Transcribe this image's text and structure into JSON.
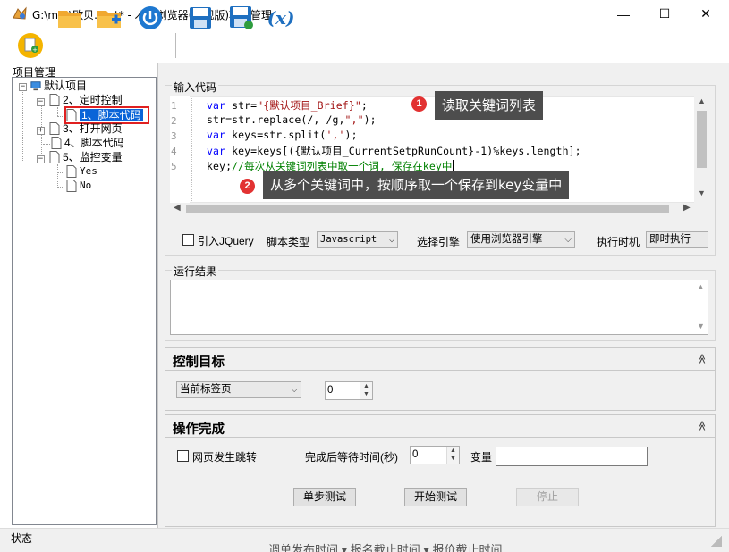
{
  "window": {
    "title": "G:\\mot\\欧贝.mot* - 木头浏览器(旗舰版)项目管理",
    "minimize": "—",
    "maximize": "☐",
    "close": "✕"
  },
  "toolbar": {
    "variable_label": "(x)"
  },
  "tree": {
    "header": "项目管理",
    "root": "默认项目",
    "nodes": [
      "2、定时控制",
      "1、脚本代码",
      "3、打开网页",
      "4、脚本代码",
      "5、监控变量",
      "Yes",
      "No"
    ]
  },
  "editor": {
    "group_title": "输入代码",
    "line_numbers": [
      "1",
      "2",
      "3",
      "4",
      "5"
    ],
    "lines": [
      [
        "var",
        " str=",
        "\"{默认项目_Brief}\"",
        ";"
      ],
      [
        "",
        "str=str.replace(/, /g,",
        "\",\"",
        ");"
      ],
      [
        "var",
        " keys=str.split(",
        "','",
        ");"
      ],
      [
        "var",
        " key=keys[({默认项目_CurrentSetpRunCount}-1)%keys.length];",
        "",
        ""
      ],
      [
        "",
        "key;",
        "//每次从关键词列表中取一个词, 保存在key中",
        ""
      ]
    ]
  },
  "callouts": [
    {
      "badge": "1",
      "text": "读取关键词列表"
    },
    {
      "badge": "2",
      "text": "从多个关键词中，按顺序取一个保存到key变量中"
    }
  ],
  "options": {
    "jquery_label": "引入JQuery",
    "script_type_label": "脚本类型",
    "script_type_value": "Javascript",
    "engine_label": "选择引擎",
    "engine_value": "使用浏览器引擎",
    "timing_label": "执行时机",
    "timing_value": "即时执行"
  },
  "result": {
    "group_title": "运行结果"
  },
  "control_target": {
    "title": "控制目标",
    "toggle": "≫",
    "tab_value": "当前标签页",
    "index_value": "0"
  },
  "completion": {
    "title": "操作完成",
    "toggle": "≫",
    "jump_label": "网页发生跳转",
    "wait_label": "完成后等待时间(秒)",
    "wait_value": "0",
    "variable_label": "变量",
    "variable_value": ""
  },
  "buttons": {
    "step_test": "单步测试",
    "start_test": "开始测试",
    "stop": "停止"
  },
  "status": {
    "text": "状态",
    "background_peek": "调单发布时间 ▾         报名截止时间 ▾         报价截止时间"
  }
}
